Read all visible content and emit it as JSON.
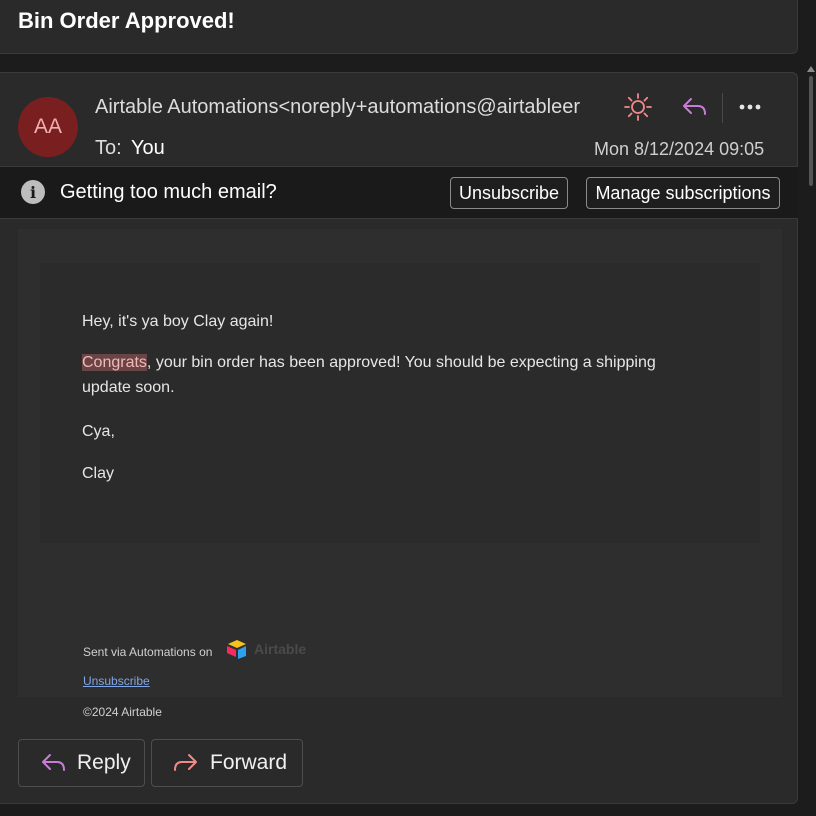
{
  "subject": "Bin Order Approved!",
  "header": {
    "avatar_initials": "AA",
    "sender": "Airtable Automations<noreply+automations@airtableer",
    "to_label": "To:",
    "to_value": "You",
    "date": "Mon 8/12/2024 09:05",
    "icons": [
      "sun-icon",
      "reply-icon",
      "more-icon"
    ]
  },
  "banner": {
    "text": "Getting too much email?",
    "unsubscribe_label": "Unsubscribe",
    "manage_label": "Manage subscriptions"
  },
  "body": {
    "greeting": "Hey, it's ya boy Clay again!",
    "highlight": "Congrats",
    "line_rest": ", your bin order has been approved! You should be expecting a shipping",
    "line_2": "update soon.",
    "signoff": "Cya,",
    "name": "Clay"
  },
  "footer": {
    "sent_via": "Sent via Automations on",
    "brand": "Airtable",
    "unsubscribe": "Unsubscribe",
    "copyright": "©2024 Airtable"
  },
  "actions": {
    "reply_label": "Reply",
    "forward_label": "Forward"
  },
  "colors": {
    "accent_reply": "#c77dd6",
    "accent_forward": "#f08a8a",
    "avatar_bg": "#7a1f1f",
    "highlight_bg": "#6b4546"
  }
}
